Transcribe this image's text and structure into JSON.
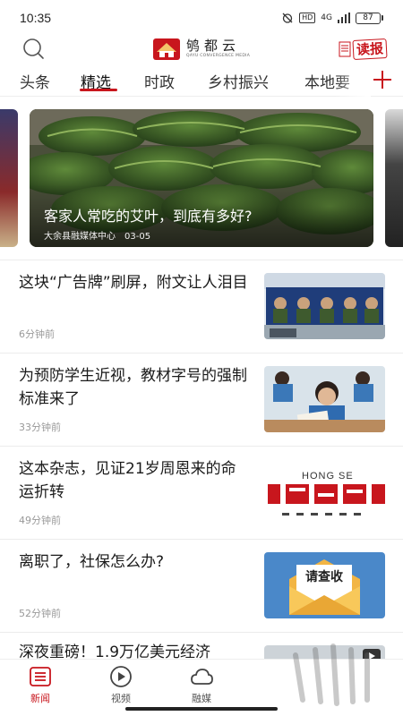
{
  "status_bar": {
    "time": "10:35",
    "network": "4G",
    "hd": "HD",
    "battery": "87"
  },
  "header": {
    "logo_title": "鸲都云",
    "logo_subtitle": "QAYU CONVERGENCE MEDIA",
    "read_paper_label": "读报"
  },
  "tabs": [
    {
      "label": "头条"
    },
    {
      "label": "精选"
    },
    {
      "label": "时政"
    },
    {
      "label": "乡村振兴"
    },
    {
      "label": "本地要"
    }
  ],
  "active_tab": "精选",
  "carousel": {
    "title": "客家人常吃的艾叶，到底有多好?",
    "source": "大余县融媒体中心",
    "date": "03-05"
  },
  "news": [
    {
      "title": "这块“广告牌”刷屏，附文让人泪目",
      "time": "6分钟前"
    },
    {
      "title": "为预防学生近视，教材字号的强制标准来了",
      "time": "33分钟前"
    },
    {
      "title": "这本杂志，见证21岁周恩来的命运折转",
      "time": "49分钟前",
      "thumb_text": "HONG SE"
    },
    {
      "title": "离职了，社保怎么办?",
      "time": "52分钟前",
      "thumb_text": "请查收"
    },
    {
      "title": "深夜重磅！1.9万亿美元经济",
      "time": ""
    }
  ],
  "bottom_nav": [
    {
      "label": "新闻"
    },
    {
      "label": "视频"
    },
    {
      "label": "融媒"
    }
  ],
  "colors": {
    "accent": "#c8161d",
    "text": "#1a1a1a",
    "muted": "#999999"
  }
}
